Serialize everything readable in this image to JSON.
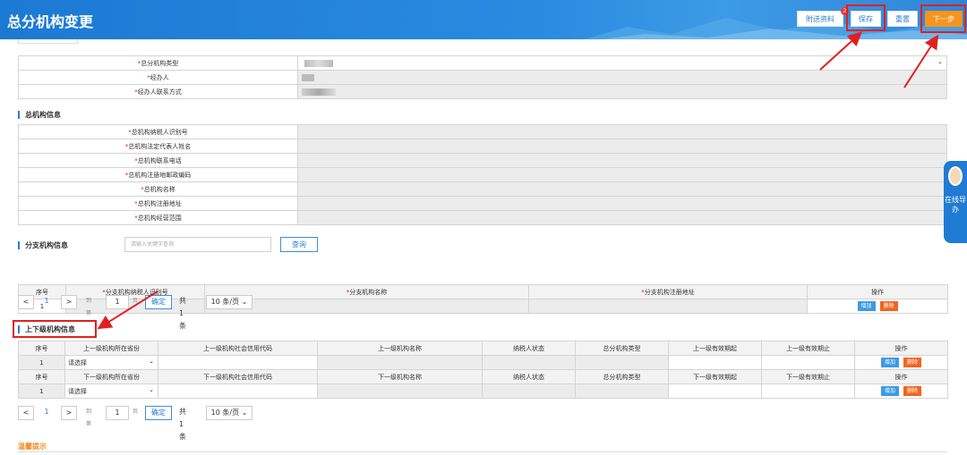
{
  "header": {
    "title": "总分机构变更",
    "buttons": {
      "attach": "附送资料",
      "save": "保存",
      "reset": "重置",
      "next": "下一步"
    },
    "save_badge": "2"
  },
  "form_top": {
    "rows": [
      {
        "label": "总分机构类型",
        "type": "select"
      },
      {
        "label": "经办人"
      },
      {
        "label": "经办人联系方式"
      }
    ]
  },
  "head_office": {
    "title": "总机构信息",
    "rows": [
      "总机构纳税人识别号",
      "总机构法定代表人姓名",
      "总机构联系电话",
      "总机构注册地邮政编码",
      "总机构名称",
      "总机构注册地址",
      "总机构经营范围"
    ]
  },
  "branch": {
    "title": "分支机构信息",
    "search_placeholder": "请输入关键字查询",
    "search_button": "查询",
    "columns": [
      "序号",
      "分支机构纳税人识别号",
      "分支机构名称",
      "分支机构注册地址",
      "操作"
    ],
    "rows": [
      {
        "index": "1"
      }
    ],
    "add": "增加",
    "delete": "删除"
  },
  "pager": {
    "prev": "<",
    "page": "1",
    "next": ">",
    "goto": "到第",
    "page_value": "1",
    "page_unit": "页",
    "confirm": "确定",
    "total": "共 1 条",
    "size": "10 条/页"
  },
  "hierarchy": {
    "title": "上下级机构信息",
    "upper_columns": [
      "序号",
      "上一级机构所在省份",
      "上一级机构社会信用代码",
      "上一级机构名称",
      "纳税人状态",
      "总分机构类型",
      "上一级有效期起",
      "上一级有效期止",
      "操作"
    ],
    "lower_columns": [
      "序号",
      "下一级机构所在省份",
      "下一级机构社会信用代码",
      "下一级机构名称",
      "纳税人状态",
      "总分机构类型",
      "下一级有效期起",
      "下一级有效期止",
      "操作"
    ],
    "row_index": "1",
    "select_placeholder": "请选择",
    "add": "增加",
    "delete": "删除"
  },
  "side_widget": {
    "text": "在线导办"
  },
  "tips": {
    "title": "温馨提示"
  },
  "colors": {
    "primary": "#1c79d4",
    "next": "#f7941d",
    "delete": "#f26522",
    "annotation": "#e02020"
  }
}
